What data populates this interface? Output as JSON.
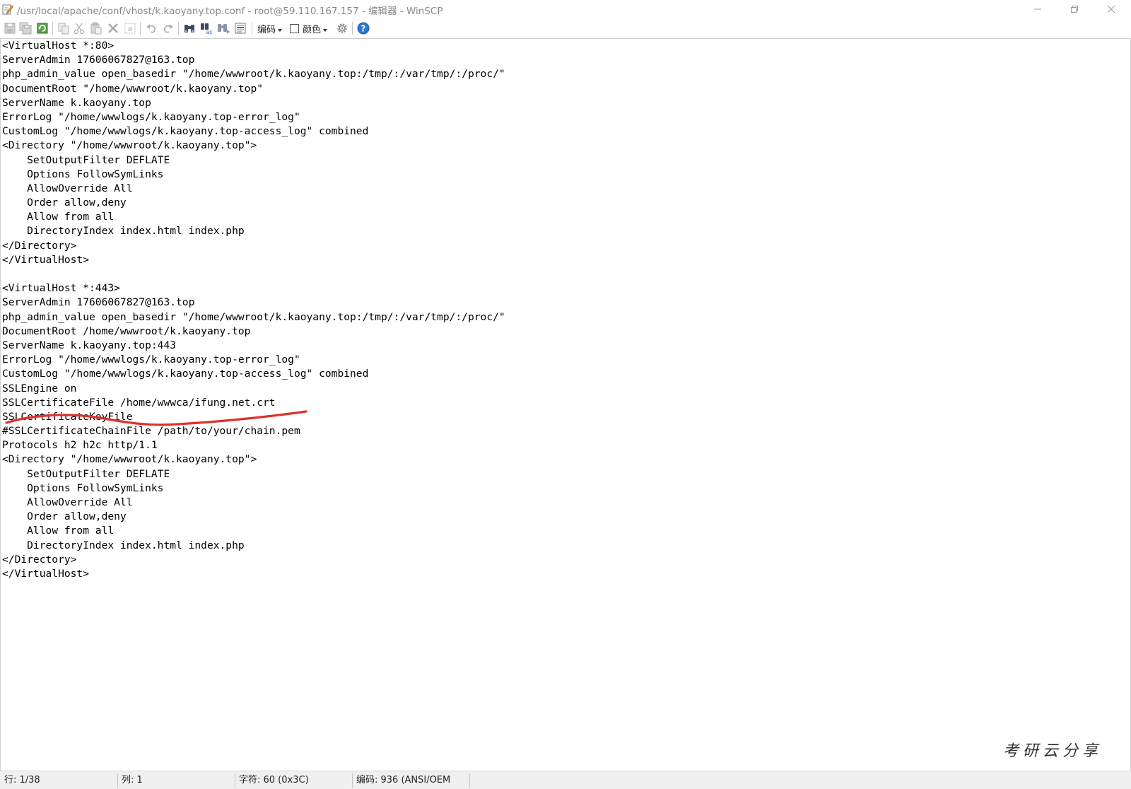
{
  "window": {
    "title": "/usr/local/apache/conf/vhost/k.kaoyany.top.conf - root@59.110.167.157 - 编辑器 - WinSCP"
  },
  "toolbar": {
    "buttons": [
      {
        "name": "save-icon"
      },
      {
        "name": "save-all-icon"
      },
      {
        "name": "reload-icon"
      },
      {
        "name": "copy-icon"
      },
      {
        "name": "cut-icon"
      },
      {
        "name": "paste-icon"
      },
      {
        "name": "delete-icon"
      },
      {
        "name": "select-all-icon"
      },
      {
        "name": "undo-icon"
      },
      {
        "name": "redo-icon"
      },
      {
        "name": "find-icon"
      },
      {
        "name": "replace-icon"
      },
      {
        "name": "find-next-icon"
      },
      {
        "name": "goto-line-icon"
      },
      {
        "name": "settings-gear-icon"
      },
      {
        "name": "help-icon"
      }
    ],
    "encoding_label": "编码",
    "color_label": "颜色"
  },
  "editor": {
    "lines": [
      "<VirtualHost *:80>",
      "ServerAdmin 17606067827@163.top",
      "php_admin_value open_basedir \"/home/wwwroot/k.kaoyany.top:/tmp/:/var/tmp/:/proc/\"",
      "DocumentRoot \"/home/wwwroot/k.kaoyany.top\"",
      "ServerName k.kaoyany.top",
      "ErrorLog \"/home/wwwlogs/k.kaoyany.top-error_log\"",
      "CustomLog \"/home/wwwlogs/k.kaoyany.top-access_log\" combined",
      "<Directory \"/home/wwwroot/k.kaoyany.top\">",
      "    SetOutputFilter DEFLATE",
      "    Options FollowSymLinks",
      "    AllowOverride All",
      "    Order allow,deny",
      "    Allow from all",
      "    DirectoryIndex index.html index.php",
      "</Directory>",
      "</VirtualHost>",
      "",
      "<VirtualHost *:443>",
      "ServerAdmin 17606067827@163.top",
      "php_admin_value open_basedir \"/home/wwwroot/k.kaoyany.top:/tmp/:/var/tmp/:/proc/\"",
      "DocumentRoot /home/wwwroot/k.kaoyany.top",
      "ServerName k.kaoyany.top:443",
      "ErrorLog \"/home/wwwlogs/k.kaoyany.top-error_log\"",
      "CustomLog \"/home/wwwlogs/k.kaoyany.top-access_log\" combined",
      "SSLEngine on",
      "SSLCertificateFile /home/wwwca/ifung.net.crt",
      "SSLCertificateKeyFile",
      "#SSLCertificateChainFile /path/to/your/chain.pem",
      "Protocols h2 h2c http/1.1",
      "<Directory \"/home/wwwroot/k.kaoyany.top\">",
      "    SetOutputFilter DEFLATE",
      "    Options FollowSymLinks",
      "    AllowOverride All",
      "    Order allow,deny",
      "    Allow from all",
      "    DirectoryIndex index.html index.php",
      "</Directory>",
      "</VirtualHost>"
    ],
    "annotation_color": "#e0312c"
  },
  "watermark": {
    "text": "考研云分享"
  },
  "statusbar": {
    "line": "行: 1/38",
    "column": "列: 1",
    "character": "字符: 60 (0x3C)",
    "encoding": "编码: 936  (ANSI/OEM"
  }
}
